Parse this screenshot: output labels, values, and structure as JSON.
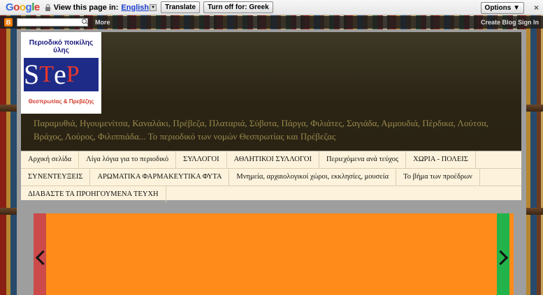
{
  "translate_bar": {
    "logo_letters": [
      "G",
      "o",
      "o",
      "g",
      "l",
      "e"
    ],
    "message": "View this page in:",
    "language": "English",
    "translate_label": "Translate",
    "turn_off_label": "Turn off for: Greek",
    "options_label": "Options ▼",
    "close_glyph": "×"
  },
  "navbar": {
    "blogger_glyph": "B",
    "more_label": "More",
    "right_links": "Create Blog   Sign In"
  },
  "header": {
    "logo_top": "Περιοδικό ποικίλης ύλης",
    "logo_main_letters": [
      "S",
      "T",
      "e",
      "P"
    ],
    "logo_bottom": "Θεσπρωτίας & Πρεβέζης",
    "tagline": "Παραμυθιά, Ηγουμενίτσα, Καναλάκι, Πρέβεζα, Πλαταριά, Σύβοτα, Πάργα, Φιλιάτες, Σαγιάδα, Αμμουδιά, Πέρδικα, Λούτσα, Βράχος, Λούρος, Φιλιππιάδα... Το περιοδικό των νομών Θεσπρωτίας και Πρέβεζας"
  },
  "menu": {
    "rows": [
      [
        "Αρχική σελίδα",
        "Λίγα λόγια για το περιοδικό",
        "ΣΥΛΛΟΓΟΙ",
        "ΑΘΛΗΤΙΚΟΙ ΣΥΛΛΟΓΟΙ",
        "Περιεχόμενα ανά τεύχος",
        "ΧΩΡΙΑ - ΠΟΛΕΙΣ"
      ],
      [
        "ΣΥΝΕΝΤΕΥΞΕΙΣ",
        "ΑΡΩΜΑΤΙΚΑ ΦΑΡΜΑΚΕΥΤΙΚΑ ΦΥΤΑ",
        "Μνημεία, αρχαιολογικοί χώροι, εκκλησίες, μουσεία",
        "Το βήμα των προέδρων"
      ],
      [
        "ΔΙΑΒΑΣΤΕ ΤΑ ΠΡΟΗΓΟΥΜΕΝΑ ΤΕΥΧΗ"
      ]
    ]
  },
  "colors": {
    "slider_bg": "#ff8c1a",
    "left_strip": "#cc4a4a",
    "right_strip": "#22b34a",
    "header_bg": "#2b2415",
    "menu_bg": "#fdf3dc"
  }
}
